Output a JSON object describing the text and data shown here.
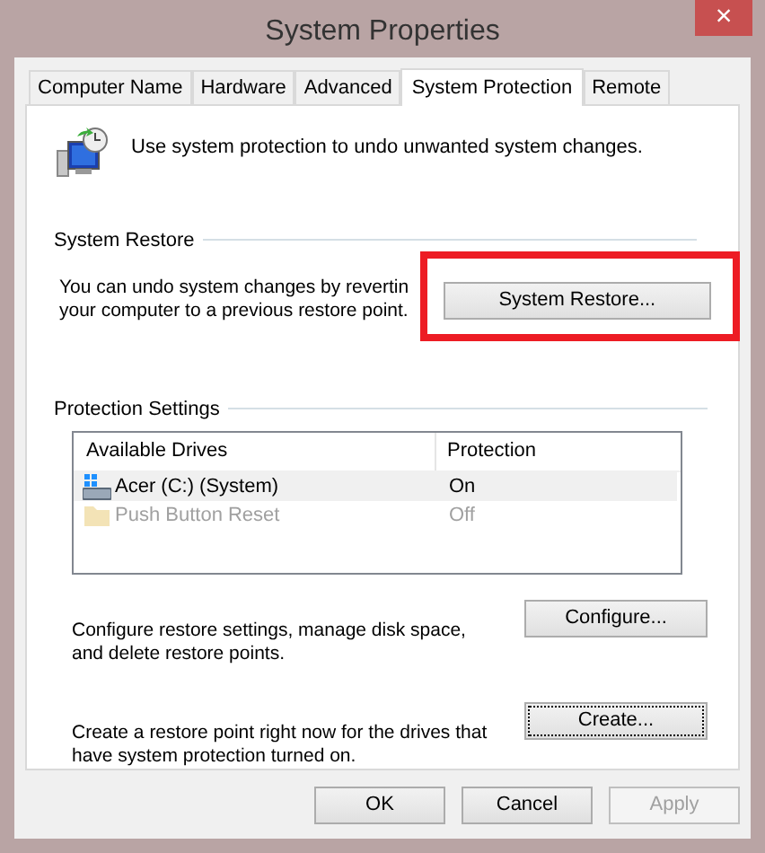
{
  "window": {
    "title": "System Properties",
    "close": "×"
  },
  "tabs": [
    {
      "label": "Computer Name",
      "selected": false
    },
    {
      "label": "Hardware",
      "selected": false
    },
    {
      "label": "Advanced",
      "selected": false
    },
    {
      "label": "System Protection",
      "selected": true
    },
    {
      "label": "Remote",
      "selected": false
    }
  ],
  "intro": "Use system protection to undo unwanted system changes.",
  "system_restore": {
    "heading": "System Restore",
    "text": "You can undo system changes by revertin\nyour computer to a previous restore point.",
    "button": "System Restore...",
    "highlighted": true
  },
  "protection_settings": {
    "heading": "Protection Settings",
    "columns": [
      "Available Drives",
      "Protection"
    ],
    "rows": [
      {
        "kind": "system",
        "drive": "Acer (C:) (System)",
        "protection": "On",
        "selected": true,
        "disabled": false
      },
      {
        "kind": "folder",
        "drive": "Push Button Reset",
        "protection": "Off",
        "selected": false,
        "disabled": true
      }
    ],
    "actions": [
      {
        "text": "Configure restore settings, manage disk space,\nand delete restore points.",
        "button": "Configure...",
        "focused": false
      },
      {
        "text": "Create a restore point right now for the drives that\nhave system protection turned on.",
        "button": "Create...",
        "focused": true
      }
    ]
  },
  "buttons": [
    {
      "label": "OK",
      "disabled": false
    },
    {
      "label": "Cancel",
      "disabled": false
    },
    {
      "label": "Apply",
      "disabled": true
    }
  ]
}
